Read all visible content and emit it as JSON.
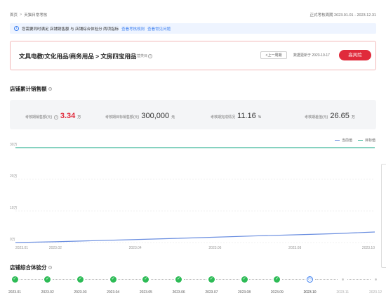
{
  "breadcrumb": {
    "home": "首页",
    "separator": ">",
    "current": "天猫日常考核"
  },
  "period": "正式考核周期 2023.01.01 - 2023.12.31",
  "notice": {
    "text": "您需要同时满足 店铺销售额 与 店铺综合体验分 两项指标",
    "link1": "查看考核规则",
    "link2": "查看常见问题"
  },
  "category": {
    "path": "文具电教/文化用品/商务用品 > 文房四宝用品",
    "sub": "考核主营类目",
    "prev_button": "<上一周期",
    "update_text": "数据更新于 2023-10-17",
    "risk_button": "高风险"
  },
  "sales": {
    "title": "店铺累计销售额",
    "stats": [
      {
        "label": "考核期销售额(元)",
        "value": "3.34",
        "unit": "万"
      },
      {
        "label": "考核期目标销售额(元)",
        "value": "300,000",
        "unit": "元"
      },
      {
        "label": "考核期完成情况",
        "value": "11.16",
        "unit": "%"
      },
      {
        "label": "考核期差值(元)",
        "value": "26.65",
        "unit": "万"
      }
    ],
    "legend": {
      "current": "当前值",
      "target": "目标值"
    },
    "colors": {
      "current": "#6a8ee0",
      "target": "#3fb89a"
    }
  },
  "chart_data": {
    "type": "line",
    "x": [
      "2023.01",
      "2023.02",
      "2023.03",
      "2023.04",
      "2023.05",
      "2023.06",
      "2023.07",
      "2023.08",
      "2023.09",
      "2023.10"
    ],
    "x_tick_labels": [
      "2023.01",
      "2023.02",
      "2023.04",
      "2023.06",
      "2023.08",
      "2023.10"
    ],
    "y_tick_labels": [
      "0万",
      "10万",
      "20万",
      "30万"
    ],
    "ylim": [
      0,
      300000
    ],
    "series": [
      {
        "name": "当前值",
        "values": [
          0,
          2500,
          6000,
          9500,
          13000,
          17000,
          21000,
          24500,
          28000,
          33400
        ]
      },
      {
        "name": "目标值",
        "values": [
          300000,
          300000,
          300000,
          300000,
          300000,
          300000,
          300000,
          300000,
          300000,
          300000
        ]
      }
    ],
    "grid": true,
    "legend": "top-right"
  },
  "score": {
    "title": "店铺综合体验分",
    "months": [
      {
        "label": "2023.01",
        "state": "done"
      },
      {
        "label": "2023.02",
        "state": "done"
      },
      {
        "label": "2023.03",
        "state": "done"
      },
      {
        "label": "2023.04",
        "state": "done"
      },
      {
        "label": "2023.05",
        "state": "done"
      },
      {
        "label": "2023.06",
        "state": "done"
      },
      {
        "label": "2023.07",
        "state": "done"
      },
      {
        "label": "2023.08",
        "state": "done"
      },
      {
        "label": "2023.09",
        "state": "done"
      },
      {
        "label": "2023.10",
        "state": "current"
      },
      {
        "label": "2023.11",
        "state": "future"
      },
      {
        "label": "2023.12",
        "state": "future"
      }
    ]
  }
}
